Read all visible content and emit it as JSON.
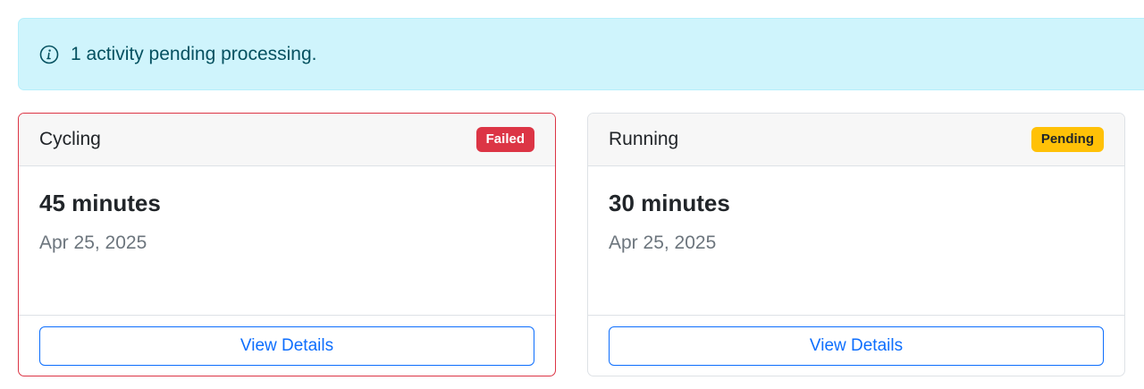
{
  "alert": {
    "message": "1 activity pending processing.",
    "icon": "info-circle-icon",
    "color": "#055160",
    "background": "#cff4fc"
  },
  "activities": [
    {
      "title": "Cycling",
      "status": "Failed",
      "status_color": "#dc3545",
      "duration": "45 minutes",
      "date": "Apr 25, 2025",
      "button_label": "View Details"
    },
    {
      "title": "Running",
      "status": "Pending",
      "status_color": "#ffc107",
      "duration": "30 minutes",
      "date": "Apr 25, 2025",
      "button_label": "View Details"
    }
  ]
}
